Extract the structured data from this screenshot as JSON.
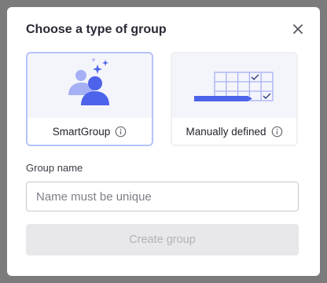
{
  "dialog": {
    "title": "Choose a type of group",
    "close_icon": "close-icon"
  },
  "options": [
    {
      "label": "SmartGroup",
      "icon": "smart-group-illustration",
      "info_icon": "info-icon",
      "selected": true
    },
    {
      "label": "Manually defined",
      "icon": "manual-grid-illustration",
      "info_icon": "info-icon",
      "selected": false
    }
  ],
  "group_name": {
    "label": "Group name",
    "placeholder": "Name must be unique",
    "value": ""
  },
  "create_button": {
    "label": "Create group",
    "disabled": true
  },
  "colors": {
    "accent": "#4d63ea",
    "accent_light": "#a6b0f5",
    "selected_border": "#b7c2fb",
    "card_bg": "#f4f5fb",
    "overlay": "#7b7b7b",
    "button_disabled_bg": "#e8e8eb",
    "button_disabled_text": "#b2b2b8"
  }
}
